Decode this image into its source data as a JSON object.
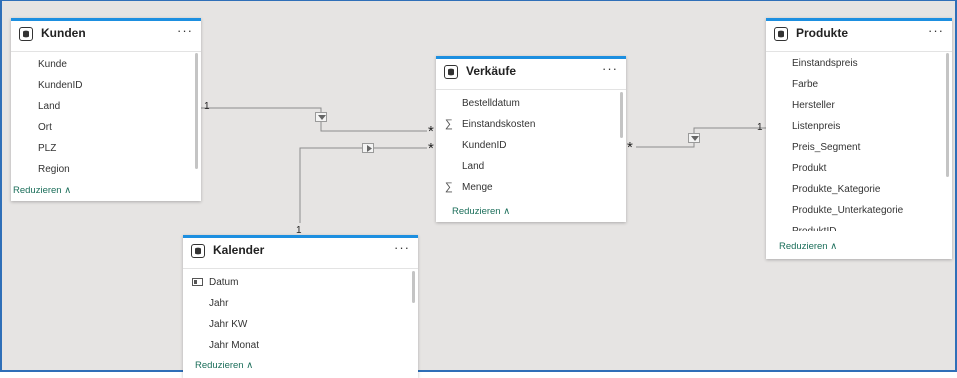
{
  "tables": {
    "kunden": {
      "title": "Kunden",
      "more": "···",
      "columns": [
        {
          "label": "Kunde",
          "icon": ""
        },
        {
          "label": "KundenID",
          "icon": ""
        },
        {
          "label": "Land",
          "icon": ""
        },
        {
          "label": "Ort",
          "icon": ""
        },
        {
          "label": "PLZ",
          "icon": ""
        },
        {
          "label": "Region",
          "icon": ""
        }
      ],
      "reduce_label": "Reduzieren ∧"
    },
    "verkaeufe": {
      "title": "Verkäufe",
      "more": "···",
      "columns": [
        {
          "label": "Bestelldatum",
          "icon": ""
        },
        {
          "label": "Einstandskosten",
          "icon": "sigma"
        },
        {
          "label": "KundenID",
          "icon": ""
        },
        {
          "label": "Land",
          "icon": ""
        },
        {
          "label": "Menge",
          "icon": "sigma"
        }
      ],
      "reduce_label": "Reduzieren ∧"
    },
    "produkte": {
      "title": "Produkte",
      "more": "···",
      "columns": [
        {
          "label": "Einstandspreis",
          "icon": ""
        },
        {
          "label": "Farbe",
          "icon": ""
        },
        {
          "label": "Hersteller",
          "icon": ""
        },
        {
          "label": "Listenpreis",
          "icon": ""
        },
        {
          "label": "Preis_Segment",
          "icon": ""
        },
        {
          "label": "Produkt",
          "icon": ""
        },
        {
          "label": "Produkte_Kategorie",
          "icon": ""
        },
        {
          "label": "Produkte_Unterkategorie",
          "icon": ""
        },
        {
          "label": "ProduktID",
          "icon": ""
        }
      ],
      "reduce_label": "Reduzieren ∧"
    },
    "kalender": {
      "title": "Kalender",
      "more": "···",
      "columns": [
        {
          "label": "Datum",
          "icon": "calendar"
        },
        {
          "label": "Jahr",
          "icon": ""
        },
        {
          "label": "Jahr KW",
          "icon": ""
        },
        {
          "label": "Jahr Monat",
          "icon": ""
        }
      ],
      "reduce_label": "Reduzieren ∧"
    }
  },
  "relationships": [
    {
      "from": "Kunden",
      "to": "Verkäufe",
      "from_cardinality": "1",
      "to_cardinality": "*",
      "filter_direction": "single"
    },
    {
      "from": "Kalender",
      "to": "Verkäufe",
      "from_cardinality": "1",
      "to_cardinality": "*",
      "filter_direction": "single"
    },
    {
      "from": "Produkte",
      "to": "Verkäufe",
      "from_cardinality": "1",
      "to_cardinality": "*",
      "filter_direction": "single"
    }
  ],
  "colors": {
    "accent": "#1d8fe0",
    "reduce_link": "#1b6e5a",
    "canvas": "#e6e4e3",
    "frame": "#2f6fb8",
    "line": "#8c8c8c"
  }
}
